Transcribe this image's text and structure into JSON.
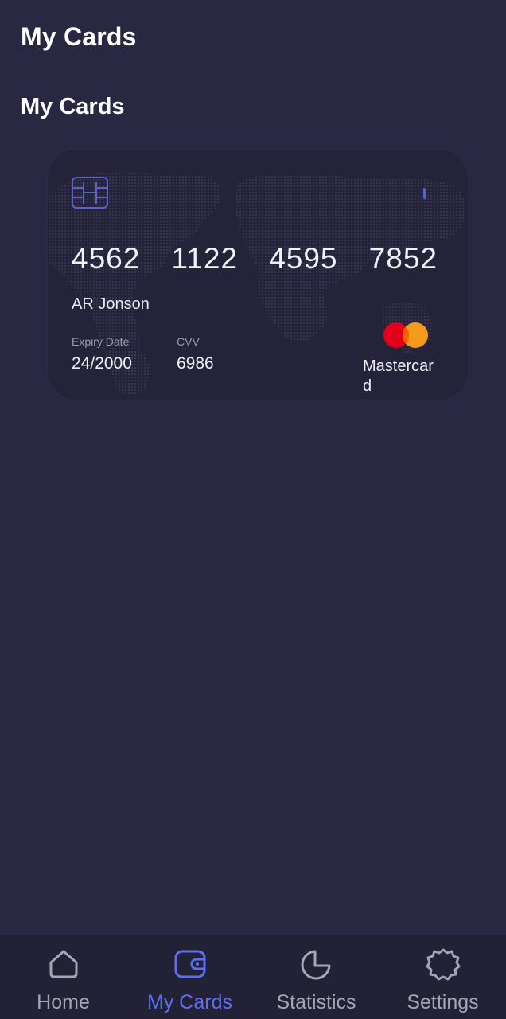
{
  "header": {
    "title": "My Cards"
  },
  "section": {
    "title": "My Cards"
  },
  "card": {
    "number_groups": [
      "4562",
      "1122",
      "4595",
      "7852"
    ],
    "holder": "AR Jonson",
    "expiry_label": "Expiry Date",
    "expiry_value": "24/2000",
    "cvv_label": "CVV",
    "cvv_value": "6986",
    "brand": "Mastercard",
    "chip_icon": "card-chip-icon",
    "brand_icon": "mastercard-logo",
    "colors": {
      "card_bg": "#25233a",
      "mc_red": "#e3001b",
      "mc_orange": "#f49b1c"
    }
  },
  "nav": {
    "items": [
      {
        "label": "Home",
        "icon": "home-icon",
        "active": false
      },
      {
        "label": "My Cards",
        "icon": "wallet-icon",
        "active": true
      },
      {
        "label": "Statistics",
        "icon": "pie-chart-icon",
        "active": false
      },
      {
        "label": "Settings",
        "icon": "gear-icon",
        "active": false
      }
    ],
    "active_color": "#5b6ff0",
    "inactive_color": "#a6a5b2"
  },
  "theme": {
    "background": "#2a2742",
    "nav_background": "#232136"
  }
}
